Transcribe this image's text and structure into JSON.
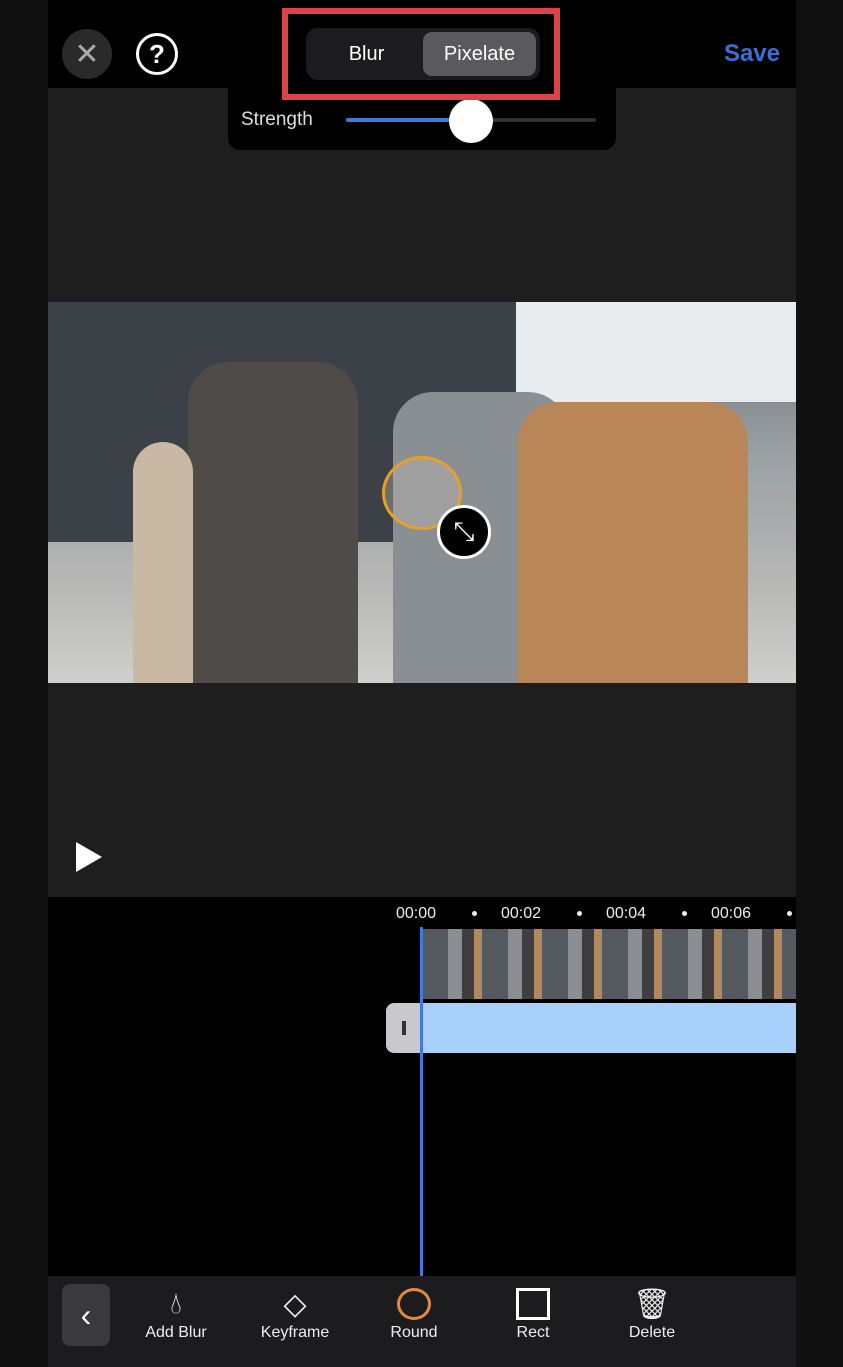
{
  "header": {
    "close_icon": "close-icon",
    "help_icon": "help-icon",
    "save_label": "Save"
  },
  "mode_toggle": {
    "options": [
      "Blur",
      "Pixelate"
    ],
    "selected": "Pixelate",
    "highlight_color": "#e0424a"
  },
  "strength": {
    "label": "Strength",
    "value_percent": 50
  },
  "timeline": {
    "ticks": [
      "00:00",
      "00:02",
      "00:04",
      "00:06"
    ],
    "playhead_color": "#3d7be0"
  },
  "toolbar": {
    "items": [
      {
        "label": "Add Blur",
        "icon": "add-blur-drop-icon"
      },
      {
        "label": "Keyframe",
        "icon": "keyframe-diamond-icon"
      },
      {
        "label": "Round",
        "icon": "circle-icon",
        "active": true
      },
      {
        "label": "Rect",
        "icon": "square-icon"
      },
      {
        "label": "Delete",
        "icon": "trash-icon"
      }
    ]
  },
  "colors": {
    "accent": "#3b6fd8",
    "active_tool": "#e58a3a",
    "mask_border": "#e6a02a"
  }
}
